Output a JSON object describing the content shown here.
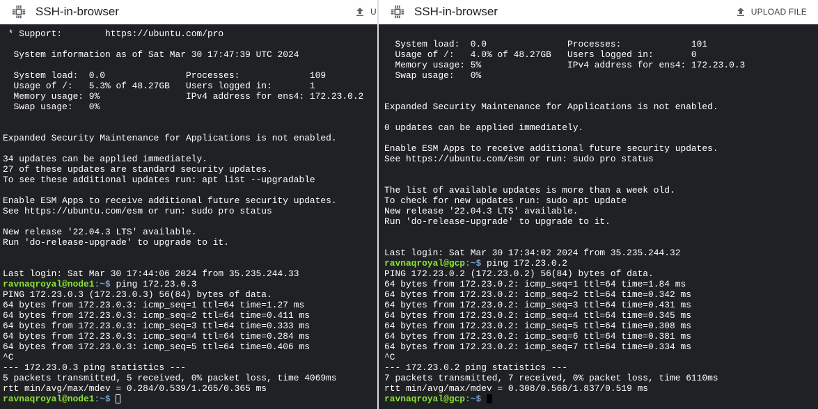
{
  "left_window": {
    "title": "SSH-in-browser",
    "upload_label": "U",
    "output_lines": [
      " * Support:        https://ubuntu.com/pro",
      "",
      "  System information as of Sat Mar 30 17:47:39 UTC 2024",
      "",
      "  System load:  0.0               Processes:             109",
      "  Usage of /:   5.3% of 48.27GB   Users logged in:       1",
      "  Memory usage: 9%                IPv4 address for ens4: 172.23.0.2",
      "  Swap usage:   0%",
      "",
      "",
      "Expanded Security Maintenance for Applications is not enabled.",
      "",
      "34 updates can be applied immediately.",
      "27 of these updates are standard security updates.",
      "To see these additional updates run: apt list --upgradable",
      "",
      "Enable ESM Apps to receive additional future security updates.",
      "See https://ubuntu.com/esm or run: sudo pro status",
      "",
      "New release '22.04.3 LTS' available.",
      "Run 'do-release-upgrade' to upgrade to it.",
      "",
      "",
      "Last login: Sat Mar 30 17:44:06 2024 from 35.235.244.33"
    ],
    "prompt_user": "ravnaqroyal@node1",
    "prompt_path": ":~$ ",
    "command": "ping 172.23.0.3",
    "ping_lines": [
      "PING 172.23.0.3 (172.23.0.3) 56(84) bytes of data.",
      "64 bytes from 172.23.0.3: icmp_seq=1 ttl=64 time=1.27 ms",
      "64 bytes from 172.23.0.3: icmp_seq=2 ttl=64 time=0.411 ms",
      "64 bytes from 172.23.0.3: icmp_seq=3 ttl=64 time=0.333 ms",
      "64 bytes from 172.23.0.3: icmp_seq=4 ttl=64 time=0.284 ms",
      "64 bytes from 172.23.0.3: icmp_seq=5 ttl=64 time=0.406 ms",
      "^C",
      "--- 172.23.0.3 ping statistics ---",
      "5 packets transmitted, 5 received, 0% packet loss, time 4069ms",
      "rtt min/avg/max/mdev = 0.284/0.539/1.265/0.365 ms"
    ]
  },
  "right_window": {
    "title": "SSH-in-browser",
    "upload_label": "UPLOAD FILE",
    "output_lines": [
      "",
      "  System load:  0.0               Processes:             101",
      "  Usage of /:   4.0% of 48.27GB   Users logged in:       0",
      "  Memory usage: 5%                IPv4 address for ens4: 172.23.0.3",
      "  Swap usage:   0%",
      "",
      "",
      "Expanded Security Maintenance for Applications is not enabled.",
      "",
      "0 updates can be applied immediately.",
      "",
      "Enable ESM Apps to receive additional future security updates.",
      "See https://ubuntu.com/esm or run: sudo pro status",
      "",
      "",
      "The list of available updates is more than a week old.",
      "To check for new updates run: sudo apt update",
      "New release '22.04.3 LTS' available.",
      "Run 'do-release-upgrade' to upgrade to it.",
      "",
      "",
      "Last login: Sat Mar 30 17:34:02 2024 from 35.235.244.32"
    ],
    "prompt_user": "ravnaqroyal@gcp",
    "prompt_path": ":~$ ",
    "command": "ping 172.23.0.2",
    "ping_lines": [
      "PING 172.23.0.2 (172.23.0.2) 56(84) bytes of data.",
      "64 bytes from 172.23.0.2: icmp_seq=1 ttl=64 time=1.84 ms",
      "64 bytes from 172.23.0.2: icmp_seq=2 ttl=64 time=0.342 ms",
      "64 bytes from 172.23.0.2: icmp_seq=3 ttl=64 time=0.431 ms",
      "64 bytes from 172.23.0.2: icmp_seq=4 ttl=64 time=0.345 ms",
      "64 bytes from 172.23.0.2: icmp_seq=5 ttl=64 time=0.308 ms",
      "64 bytes from 172.23.0.2: icmp_seq=6 ttl=64 time=0.381 ms",
      "64 bytes from 172.23.0.2: icmp_seq=7 ttl=64 time=0.334 ms",
      "^C",
      "--- 172.23.0.2 ping statistics ---",
      "7 packets transmitted, 7 received, 0% packet loss, time 6110ms",
      "rtt min/avg/max/mdev = 0.308/0.568/1.837/0.519 ms"
    ]
  },
  "colors": {
    "terminal_bg": "#202124",
    "terminal_fg": "#ffffff",
    "prompt_user": "#8ae234",
    "prompt_path": "#729fcf"
  },
  "icons": {
    "app": "chip-icon",
    "upload": "upload-icon"
  }
}
